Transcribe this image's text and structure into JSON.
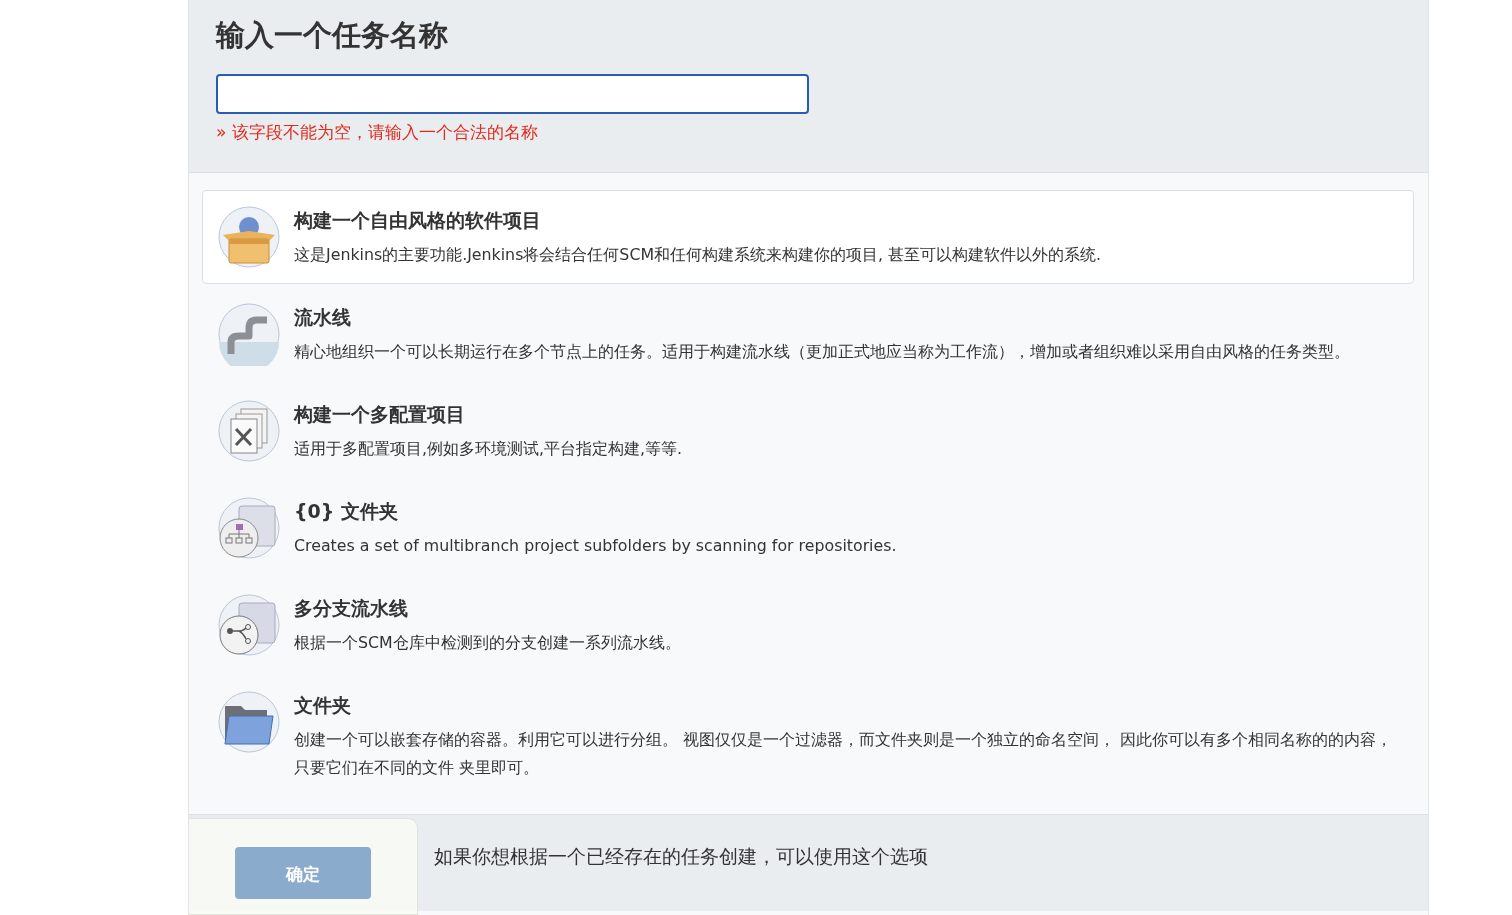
{
  "header": {
    "title": "输入一个任务名称",
    "name_field": {
      "focused": true
    },
    "error": "» 该字段不能为空，请输入一个合法的名称"
  },
  "job_types": [
    {
      "kind": "freestyle",
      "title": "构建一个自由风格的软件项目",
      "description": "这是Jenkins的主要功能.Jenkins将会结合任何SCM和任何构建系统来构建你的项目, 甚至可以构建软件以外的系统.",
      "selected": true
    },
    {
      "kind": "pipeline",
      "title": "流水线",
      "description": "精心地组织一个可以长期运行在多个节点上的任务。适用于构建流水线（更加正式地应当称为工作流），增加或者组织难以采用自由风格的任务类型。",
      "selected": false
    },
    {
      "kind": "multiconfig",
      "title": "构建一个多配置项目",
      "description": "适用于多配置项目,例如多环境测试,平台指定构建,等等.",
      "selected": false
    },
    {
      "kind": "orgfolder",
      "title": "{0} 文件夹",
      "description": "Creates a set of multibranch project subfolders by scanning for repositories.",
      "selected": false
    },
    {
      "kind": "multibranch",
      "title": "多分支流水线",
      "description": "根据一个SCM仓库中检测到的分支创建一系列流水线。",
      "selected": false
    },
    {
      "kind": "folder",
      "title": "文件夹",
      "description": "创建一个可以嵌套存储的容器。利用它可以进行分组。 视图仅仅是一个过滤器，而文件夹则是一个独立的命名空间， 因此你可以有多个相同名称的的内容，只要它们在不同的文件 夹里即可。",
      "selected": false
    }
  ],
  "copy_section": {
    "hint": "如果你想根据一个已经存在的任务创建，可以使用这个选项"
  },
  "footer": {
    "ok_button": "确定",
    "disabled": true
  }
}
